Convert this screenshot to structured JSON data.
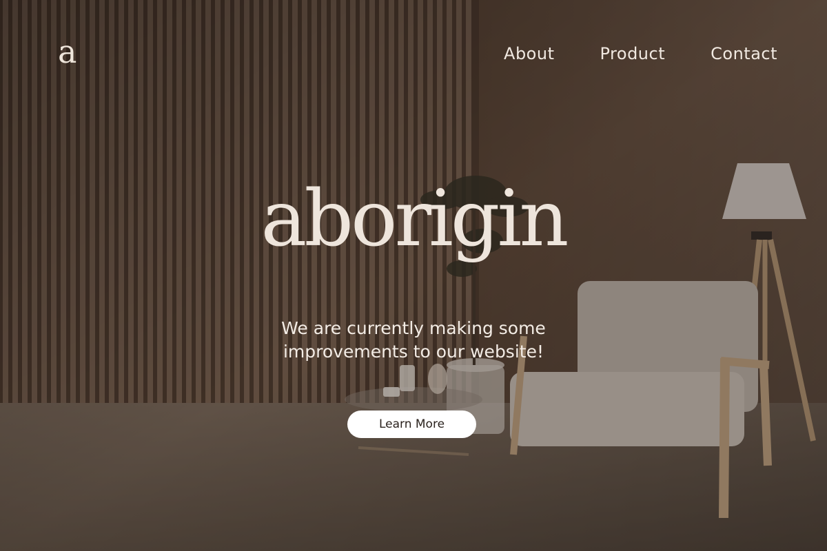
{
  "brand": {
    "logo_mark": "a",
    "name": "aborigin"
  },
  "nav": {
    "items": [
      "About",
      "Product",
      "Contact"
    ]
  },
  "hero": {
    "line1": "We are currently making some",
    "line2": "improvements to our website!",
    "cta_label": "Learn More"
  },
  "colors": {
    "text_light": "#eee5dc",
    "button_bg": "#ffffff",
    "button_text": "#2a221d",
    "overlay": "#3b2e25"
  }
}
